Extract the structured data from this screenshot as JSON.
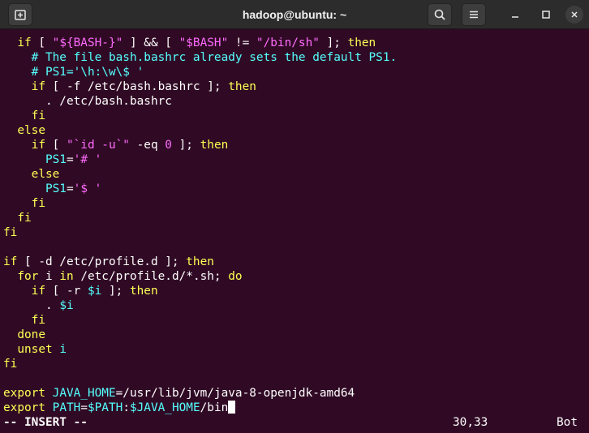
{
  "window": {
    "title": "hadoop@ubuntu: ~"
  },
  "icons": {
    "new_tab": "new-tab-icon",
    "search": "search-icon",
    "menu": "hamburger-menu-icon",
    "minimize": "minimize-icon",
    "maximize": "maximize-icon",
    "close": "close-icon"
  },
  "editor": {
    "lines": [
      "  if [ \"${BASH-}\" ] && [ \"$BASH\" != \"/bin/sh\" ]; then",
      "    # The file bash.bashrc already sets the default PS1.",
      "    # PS1='\\h:\\w\\$ '",
      "    if [ -f /etc/bash.bashrc ]; then",
      "      . /etc/bash.bashrc",
      "    fi",
      "  else",
      "    if [ \"`id -u`\" -eq 0 ]; then",
      "      PS1='# '",
      "    else",
      "      PS1='$ '",
      "    fi",
      "  fi",
      "fi",
      "",
      "if [ -d /etc/profile.d ]; then",
      "  for i in /etc/profile.d/*.sh; do",
      "    if [ -r $i ]; then",
      "      . $i",
      "    fi",
      "  done",
      "  unset i",
      "fi",
      "",
      "export JAVA_HOME=/usr/lib/jvm/java-8-openjdk-amd64",
      "export PATH=$PATH:$JAVA_HOME/bin"
    ]
  },
  "status": {
    "mode": "-- INSERT --",
    "position": "30,33",
    "scroll": "Bot"
  },
  "colors": {
    "terminal_bg": "#300a24",
    "keyword": "#ffff54",
    "string": "#ff6bff",
    "comment": "#54ffff",
    "variable": "#54ffff",
    "text": "#ffffff",
    "titlebar_bg": "#2c2c2c"
  }
}
